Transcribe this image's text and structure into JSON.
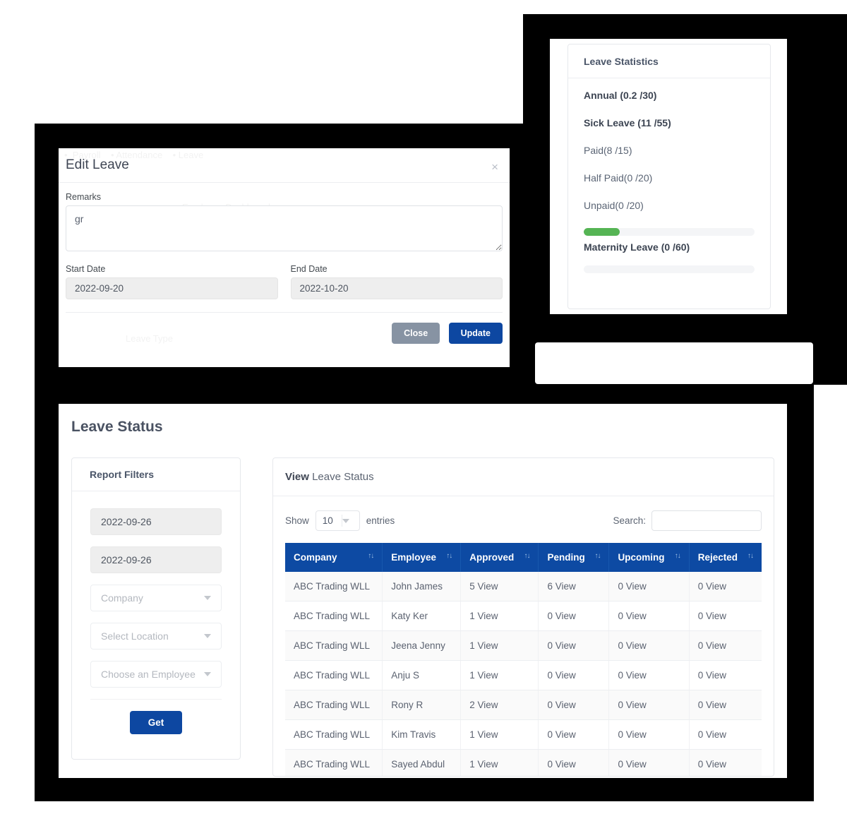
{
  "stats": {
    "title": "Leave Statistics",
    "items": [
      {
        "label": "Annual (0.2 /30)",
        "bold": true
      },
      {
        "label": "Sick Leave (11 /55)",
        "bold": true
      },
      {
        "label": "Paid(8 /15)",
        "bold": false
      },
      {
        "label": "Half Paid(0 /20)",
        "bold": false
      },
      {
        "label": "Unpaid(0 /20)",
        "bold": false
      }
    ],
    "bar1": {
      "percent": 21,
      "color": "#55b454",
      "track": "#f4f5f7"
    },
    "maternity_label": "Maternity Leave (0 /60)",
    "bar2": {
      "percent": 0,
      "color": "#55b454",
      "track": "#f4f5f7"
    }
  },
  "modal": {
    "title": "Edit Leave",
    "close_icon": "×",
    "remarks_label": "Remarks",
    "remarks_value": "gr",
    "start_label": "Start Date",
    "start_value": "2022-09-20",
    "end_label": "End Date",
    "end_value": "2022-10-20",
    "close_label": "Close",
    "update_label": "Update",
    "close_color": "#8793a3",
    "update_color": "#0d47a1"
  },
  "leave_status": {
    "page_title": "Leave Status",
    "filters": {
      "title": "Report Filters",
      "from_date": "2022-09-26",
      "to_date": "2022-09-26",
      "company_placeholder": "Company",
      "location_placeholder": "Select Location",
      "employee_placeholder": "Choose an Employee",
      "get_label": "Get",
      "get_color": "#0d47a1"
    },
    "table_panel": {
      "head_strong": "View",
      "head_rest": " Leave Status",
      "show_label": "Show",
      "entries_label": "entries",
      "page_length": "10",
      "search_label": "Search:",
      "search_value": "",
      "search_placeholder": "",
      "header_color": "#0d4aa3",
      "sort_icon": "↑↓",
      "columns": [
        "Company",
        "Employee",
        "Approved",
        "Pending",
        "Upcoming",
        "Rejected"
      ],
      "rows": [
        [
          "ABC Trading WLL",
          "John James",
          "5 View",
          "6 View",
          "0 View",
          "0 View"
        ],
        [
          "ABC Trading WLL",
          "Katy Ker",
          "1 View",
          "0 View",
          "0 View",
          "0 View"
        ],
        [
          "ABC Trading WLL",
          "Jeena Jenny",
          "1 View",
          "0 View",
          "0 View",
          "0 View"
        ],
        [
          "ABC Trading WLL",
          "Anju S",
          "1 View",
          "0 View",
          "0 View",
          "0 View"
        ],
        [
          "ABC Trading WLL",
          "Rony R",
          "2 View",
          "0 View",
          "0 View",
          "0 View"
        ],
        [
          "ABC Trading WLL",
          "Kim Travis",
          "1 View",
          "0 View",
          "0 View",
          "0 View"
        ],
        [
          "ABC Trading WLL",
          "Sayed Abdul",
          "1 View",
          "0 View",
          "0 View",
          "0 View"
        ]
      ]
    }
  }
}
